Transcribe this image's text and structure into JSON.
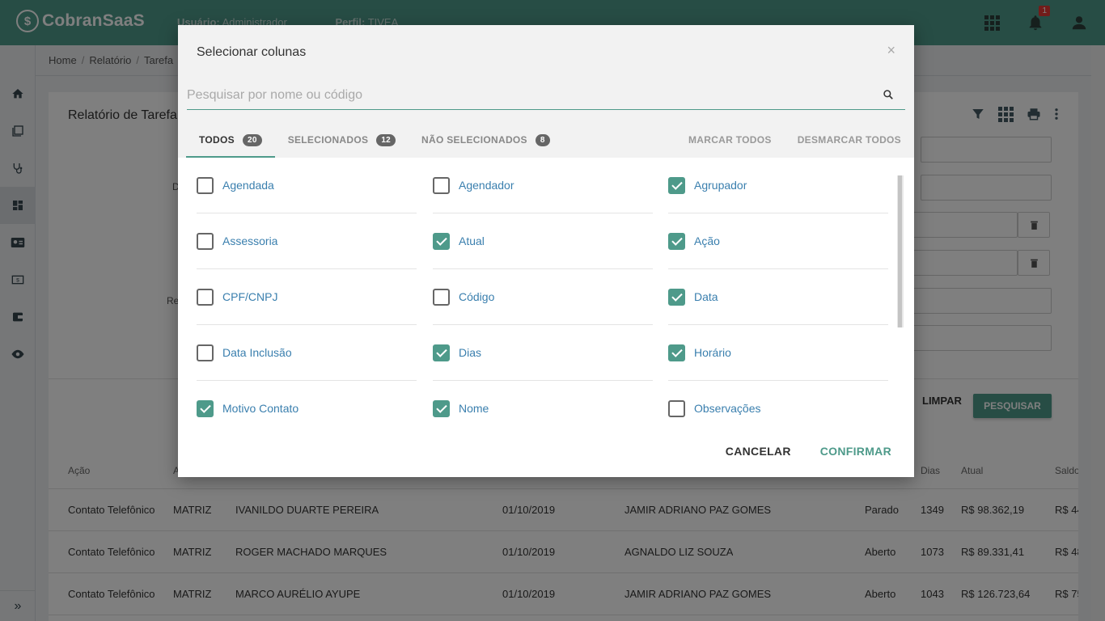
{
  "app": {
    "logo_mark": "$",
    "logo_text": "CobranSaaS",
    "user_label": "Usuário:",
    "user_value": "Administrador",
    "profile_label": "Perfil:",
    "profile_value": "TIVEA",
    "notification_count": "1",
    "accent_color": "#4e9a8a"
  },
  "breadcrumb": [
    "Home",
    "Relatório",
    "Tarefa"
  ],
  "page": {
    "title": "Relatório de Tarefa",
    "label_d": "D",
    "label_re": "Re",
    "btn_limpar": "LIMPAR",
    "btn_pesquisar": "PESQUISAR"
  },
  "table": {
    "headers": [
      "Ação",
      "A",
      "Dias",
      "Atual",
      "Saldo"
    ],
    "rows": [
      {
        "acao": "Contato Telefônico",
        "col2": "MATRIZ",
        "nome": "IVANILDO DUARTE PEREIRA",
        "data": "01/10/2019",
        "agendador": "JAMIR ADRIANO PAZ GOMES",
        "status": "Parado",
        "dias": "1349",
        "atual": "R$ 98.362,19",
        "saldo": "R$ 44"
      },
      {
        "acao": "Contato Telefônico",
        "col2": "MATRIZ",
        "nome": "ROGER MACHADO MARQUES",
        "data": "01/10/2019",
        "agendador": "AGNALDO LIZ SOUZA",
        "status": "Aberto",
        "dias": "1073",
        "atual": "R$ 89.331,41",
        "saldo": "R$ 48"
      },
      {
        "acao": "Contato Telefônico",
        "col2": "MATRIZ",
        "nome": "MARCO AURÉLIO AYUPE",
        "data": "01/10/2019",
        "agendador": "JAMIR ADRIANO PAZ GOMES",
        "status": "Aberto",
        "dias": "1043",
        "atual": "R$ 126.723,64",
        "saldo": "R$ 75"
      }
    ]
  },
  "modal": {
    "title": "Selecionar colunas",
    "close": "×",
    "search_placeholder": "Pesquisar por nome ou código",
    "search_value": "",
    "tabs": [
      {
        "label": "TODOS",
        "count": "20"
      },
      {
        "label": "SELECIONADOS",
        "count": "12"
      },
      {
        "label": "NÃO SELECIONADOS",
        "count": "8"
      }
    ],
    "mark_all": "MARCAR TODOS",
    "unmark_all": "DESMARCAR TODOS",
    "columns": [
      {
        "label": "Agendada",
        "checked": false
      },
      {
        "label": "Agendador",
        "checked": false
      },
      {
        "label": "Agrupador",
        "checked": true
      },
      {
        "label": "Assessoria",
        "checked": false
      },
      {
        "label": "Atual",
        "checked": true
      },
      {
        "label": "Ação",
        "checked": true
      },
      {
        "label": "CPF/CNPJ",
        "checked": false
      },
      {
        "label": "Código",
        "checked": false
      },
      {
        "label": "Data",
        "checked": true
      },
      {
        "label": "Data Inclusão",
        "checked": false
      },
      {
        "label": "Dias",
        "checked": true
      },
      {
        "label": "Horário",
        "checked": true
      },
      {
        "label": "Motivo Contato",
        "checked": true
      },
      {
        "label": "Nome",
        "checked": true
      },
      {
        "label": "Observações",
        "checked": false
      }
    ],
    "cancel": "CANCELAR",
    "confirm": "CONFIRMAR"
  }
}
